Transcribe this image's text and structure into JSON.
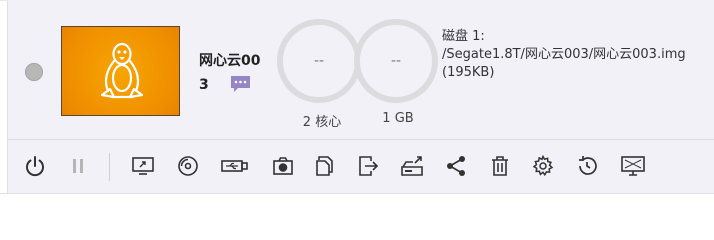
{
  "vm": {
    "name": "网心云003",
    "status_color": "#b7b7b7",
    "thumbnail_bg": "#f29500",
    "os_icon": "linux-tux-icon"
  },
  "resources": {
    "cpu": {
      "value": "--",
      "label": "2 核心"
    },
    "memory": {
      "value": "--",
      "label": "1 GB"
    }
  },
  "disk": {
    "title": "磁盘 1:",
    "path": "/Segate1.8T/网心云003/网心云003.img (195KB)"
  },
  "toolbar": [
    {
      "name": "power-icon",
      "title": "power"
    },
    {
      "name": "pause-icon",
      "title": "pause"
    },
    {
      "name": "console-icon",
      "title": "console"
    },
    {
      "name": "cd-icon",
      "title": "cd"
    },
    {
      "name": "usb-icon",
      "title": "usb"
    },
    {
      "name": "snapshot-icon",
      "title": "snapshot"
    },
    {
      "name": "clone-icon",
      "title": "clone"
    },
    {
      "name": "export-icon",
      "title": "export"
    },
    {
      "name": "disk-export-icon",
      "title": "disk"
    },
    {
      "name": "share-icon",
      "title": "share"
    },
    {
      "name": "trash-icon",
      "title": "delete"
    },
    {
      "name": "gear-icon",
      "title": "settings"
    },
    {
      "name": "history-icon",
      "title": "history"
    },
    {
      "name": "monitor-icon",
      "title": "display"
    }
  ]
}
